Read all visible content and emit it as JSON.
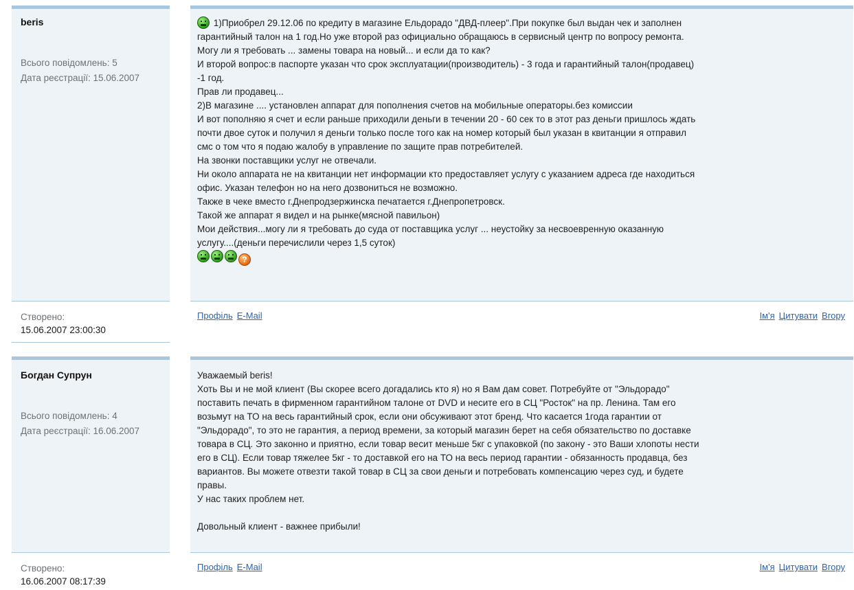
{
  "posts": [
    {
      "author": "beris",
      "message_count": "Всього повідомлень: 5",
      "registered": "Дата реєстрації: 15.06.2007",
      "created_label": "Створено:",
      "created_value": "15.06.2007 23:00:30",
      "lines": [
        "1)Приобрел 29.12.06 по кредиту в магазине Ельдорадо \"ДВД-плеер\".При покупке был выдан чек и заполнен",
        "гарантийный талон на 1 год.Но уже второй раз официально обращаюсь в сервисный центр по вопросу ремонта.",
        "Могу ли я требовать ... замены товара на новый... и если да то как?",
        "И второй вопрос:в паспорте указан что срок эксплуатации(производитель) - 3 года и гарантийный талон(продавец)",
        "-1 год.",
        "Прав ли продавец...",
        "2)В магазине .... установлен аппарат для пополнения счетов на мобильные операторы.без комиссии",
        "И вот пополняю я счет и если раньше приходили деньги в течении 20 - 60 сек то в этот раз деньги пришлось ждать",
        "почти двое суток и получил я деньги только после того как на номер который был указан в квитанции я отправил",
        "смс о том что я подаю жалобу в управление по защите прав потребителей.",
        "На звонки поставщики услуг не отвечали.",
        "Ни около аппарата не на квитанции нет информации кто предоставляет услугу с указанием адреса где находиться",
        "офис. Указан телефон но на него дозвониться не возможно.",
        "Также в чеке вместо г.Днепродзержинска печатается г.Днепропетровск.",
        "Такой же аппарат я видел и на рынке(мясной павильон)",
        "Мои действия...могу ли я требовать до суда от поставщика услуг ... неустойку за несвоевренную оказанную",
        "услугу....(деньги перечислили через 1,5 суток)"
      ],
      "emoticons": [
        "angry-smiley",
        "angry-smiley",
        "angry-smiley",
        "angry-smiley",
        "question-icon"
      ]
    },
    {
      "author": "Богдан Супрун",
      "message_count": "Всього повідомлень: 4",
      "registered": "Дата реєстрації: 16.06.2007",
      "created_label": "Створено:",
      "created_value": "16.06.2007 08:17:39",
      "lines": [
        "Уважаемый beris!",
        "Хоть Вы и не мой клиент (Вы скорее всего догадались кто я) но я Вам дам совет. Потребуйте от \"Эльдорадо\"",
        "поставить печать в фирменном гарантийном талоне от DVD и несите его в СЦ \"Росток\" на пр. Ленина. Там его",
        "возьмут на ТО на весь гарантийный срок, если они обсуживают этот бренд. Что касается 1года гарантии от",
        "\"Эльдорадо\", то это не гарантия, а период времени, за который магазин берет на себя обязательство по доставке",
        "товара в СЦ. Это законно и приятно, если товар весит меньше 5кг с упаковкой (по закону - это Ваши хлопоты нести",
        "его в СЦ). Если товар тяжелее 5кг - то доставкой его на ТО на весь период гарантии - обязанность продавца, без",
        "вариантов. Вы можете отвезти такой товар в СЦ за свои деньги и потребовать компенсацию через суд, и будете",
        "правы.",
        "У нас таких проблем нет.",
        "",
        "Довольный клиент - важнее прибыли!"
      ]
    }
  ],
  "actions": {
    "profile": "Профіль",
    "email": "E-Mail",
    "name": "Ім'я",
    "quote": "Цитувати",
    "top": "Вгору"
  },
  "colors": {
    "panel_bg": "#eef3f7",
    "accent_bar": "#a8c6de",
    "link": "#2b63b5"
  }
}
